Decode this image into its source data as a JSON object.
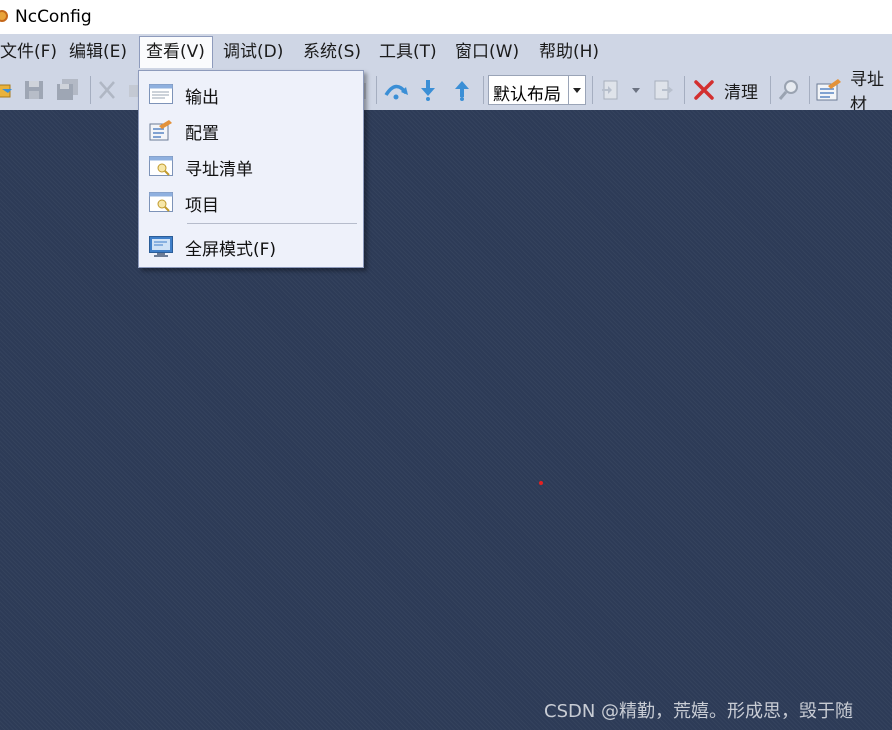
{
  "window": {
    "title": "NcConfig"
  },
  "menubar": {
    "items": [
      {
        "label": "文件(F)"
      },
      {
        "label": "编辑(E)"
      },
      {
        "label": "查看(V)",
        "active": true
      },
      {
        "label": "调试(D)"
      },
      {
        "label": "系统(S)"
      },
      {
        "label": "工具(T)"
      },
      {
        "label": "窗口(W)"
      },
      {
        "label": "帮助(H)"
      }
    ]
  },
  "view_menu": {
    "items": [
      {
        "label": "输出",
        "icon": "output-window-icon"
      },
      {
        "label": "配置",
        "icon": "config-icon"
      },
      {
        "label": "寻址清单",
        "icon": "address-list-icon"
      },
      {
        "label": "项目",
        "icon": "project-icon"
      },
      {
        "label": "全屏模式(F)",
        "icon": "fullscreen-icon"
      }
    ]
  },
  "toolbar": {
    "layout_select": {
      "value": "默认布局"
    },
    "clear_label": "清理",
    "address_label": "寻址材"
  },
  "watermark": "CSDN @精勤，荒嬉。形成思，毁于随",
  "colors": {
    "workspace_bg": "#2d3b57",
    "chrome_bg": "#cfd6e5",
    "menu_bg": "#eef1fa",
    "clear_icon": "#d32f2f",
    "arrow_icon": "#3b8fd6"
  }
}
